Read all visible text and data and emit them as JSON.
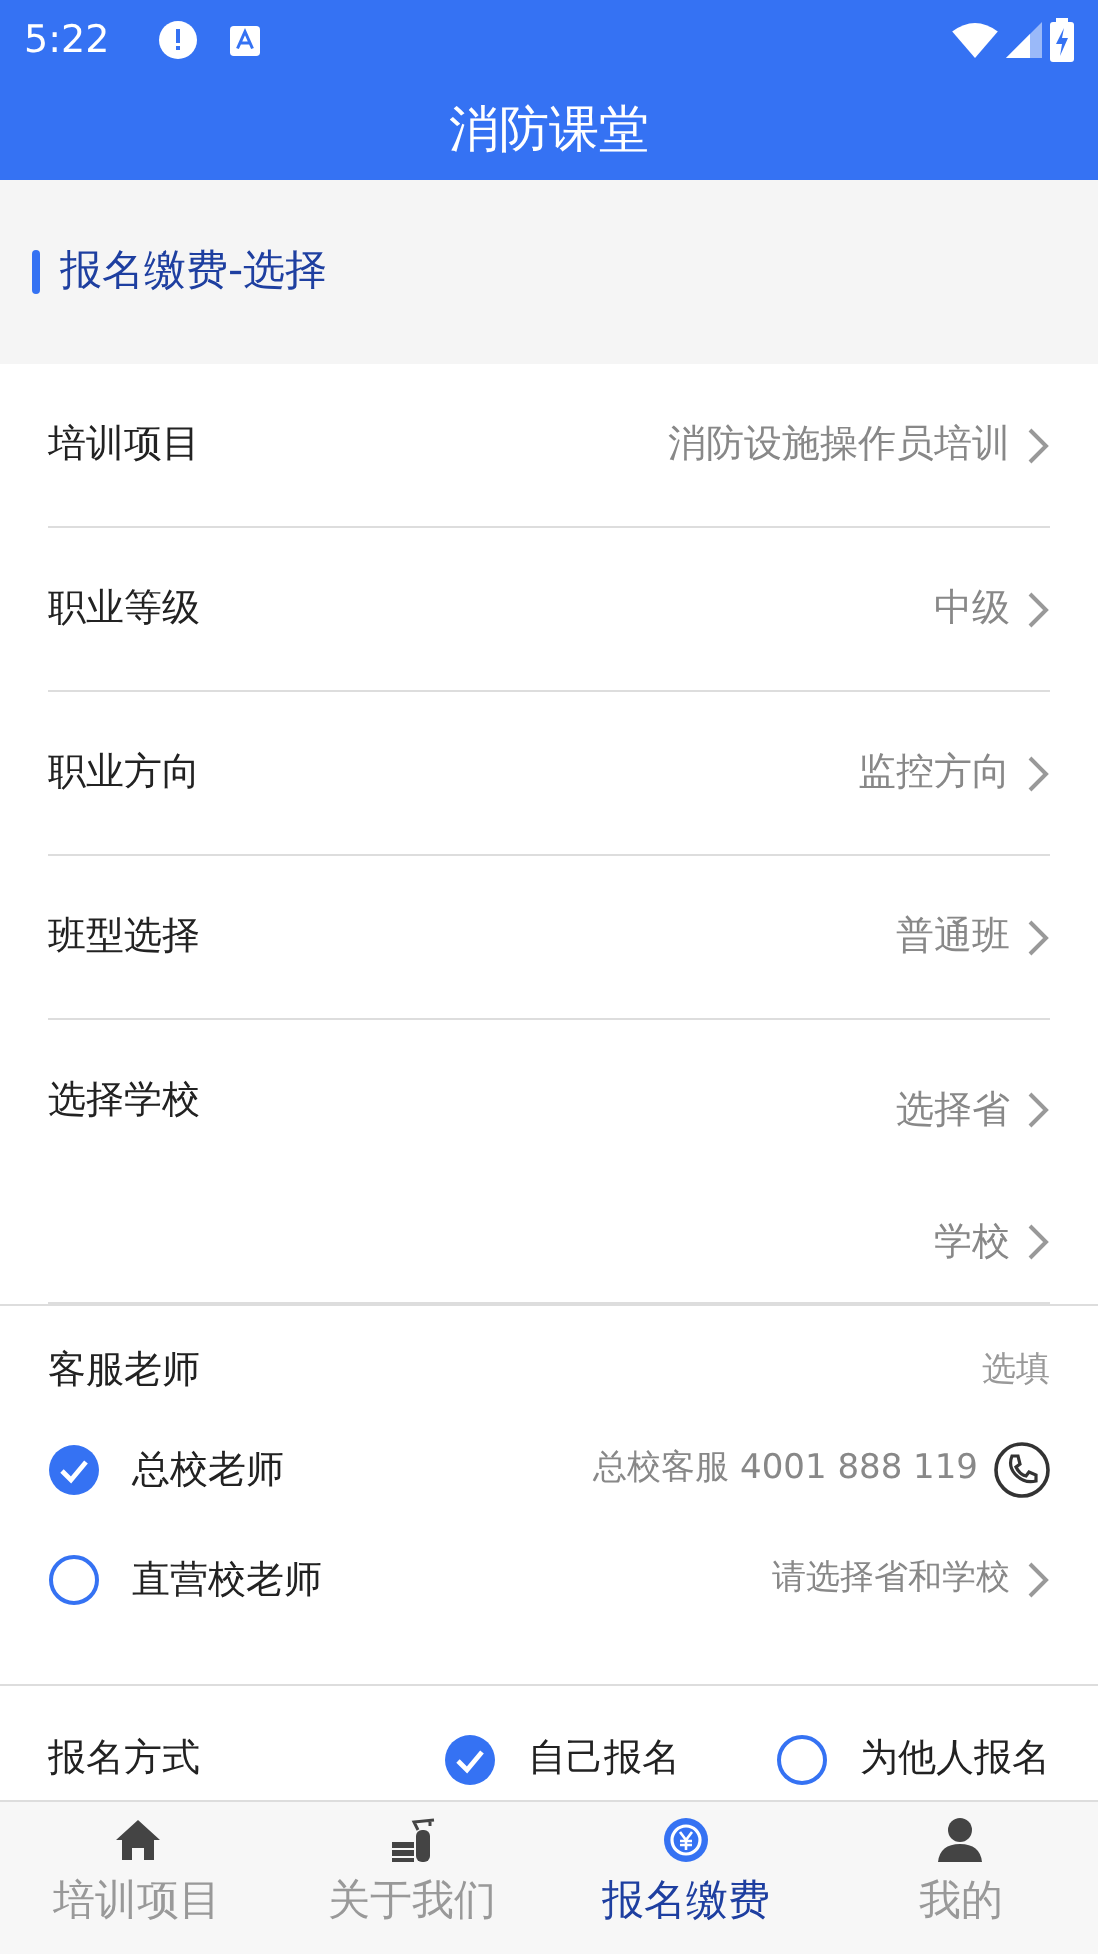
{
  "status_bar": {
    "time": "5:22"
  },
  "app_bar": {
    "title": "消防课堂"
  },
  "section": {
    "title": "报名缴费-选择"
  },
  "fields": [
    {
      "label": "培训项目",
      "values": [
        "消防设施操作员培训"
      ]
    },
    {
      "label": "职业等级",
      "values": [
        "中级"
      ]
    },
    {
      "label": "职业方向",
      "values": [
        "监控方向"
      ]
    },
    {
      "label": "班型选择",
      "values": [
        "普通班"
      ]
    },
    {
      "label": "选择学校",
      "values": [
        "选择省",
        "学校"
      ]
    }
  ],
  "service": {
    "title": "客服老师",
    "hint": "选填",
    "options": [
      {
        "label": "总校老师",
        "selected": true,
        "kind": "phone",
        "detail": "总校客服 4001 888 119"
      },
      {
        "label": "直营校老师",
        "selected": false,
        "kind": "link",
        "detail": "请选择省和学校"
      }
    ]
  },
  "signup": {
    "label": "报名方式",
    "options": [
      {
        "label": "自己报名",
        "selected": true
      },
      {
        "label": "为他人报名",
        "selected": false
      }
    ]
  },
  "tabs": [
    {
      "label": "培训项目",
      "selected": false
    },
    {
      "label": "关于我们",
      "selected": false
    },
    {
      "label": "报名缴费",
      "selected": true
    },
    {
      "label": "我的",
      "selected": false
    }
  ]
}
